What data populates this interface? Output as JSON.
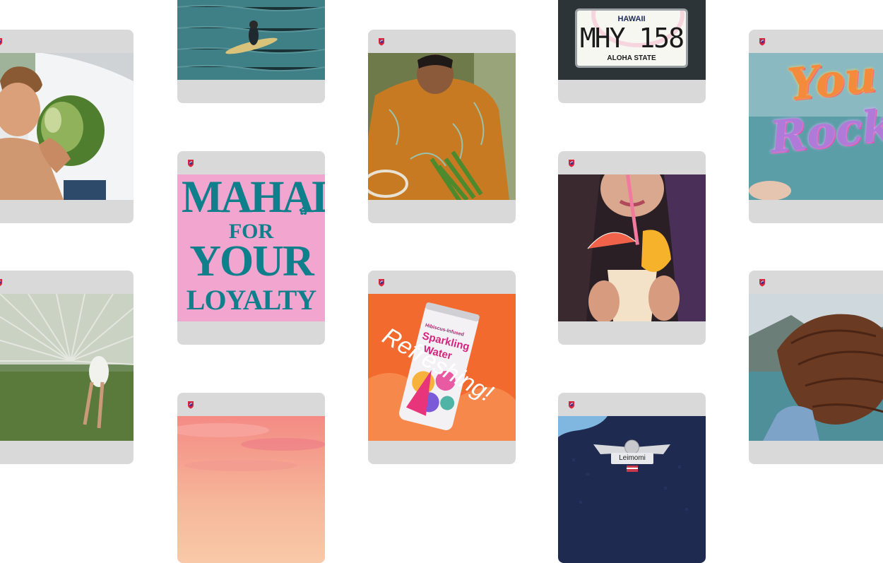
{
  "cards": {
    "mahalo": {
      "line1": "MAHALO",
      "line2": "FOR",
      "line3": "YOUR",
      "line4": "LOYALTY"
    },
    "plate": {
      "state": "HAWAII",
      "number": "MHY 158",
      "tagline": "ALOHA STATE"
    },
    "you_rock": {
      "line1": "You",
      "line2": "Rock"
    },
    "sparkling": {
      "can_brand": "Hibiscus-Infused",
      "can_line1": "Sparkling",
      "can_line2": "Water",
      "headline": "Refreshing!"
    },
    "pin": {
      "name": "Leimomi"
    }
  },
  "colors": {
    "card_bg": "#d9d9d9",
    "logo_purple": "#4b2d83",
    "logo_red": "#d7263d",
    "mahalo_pink": "#f2a6cf",
    "mahalo_teal": "#0f7f8c",
    "sparkling_orange": "#f26a2e"
  }
}
